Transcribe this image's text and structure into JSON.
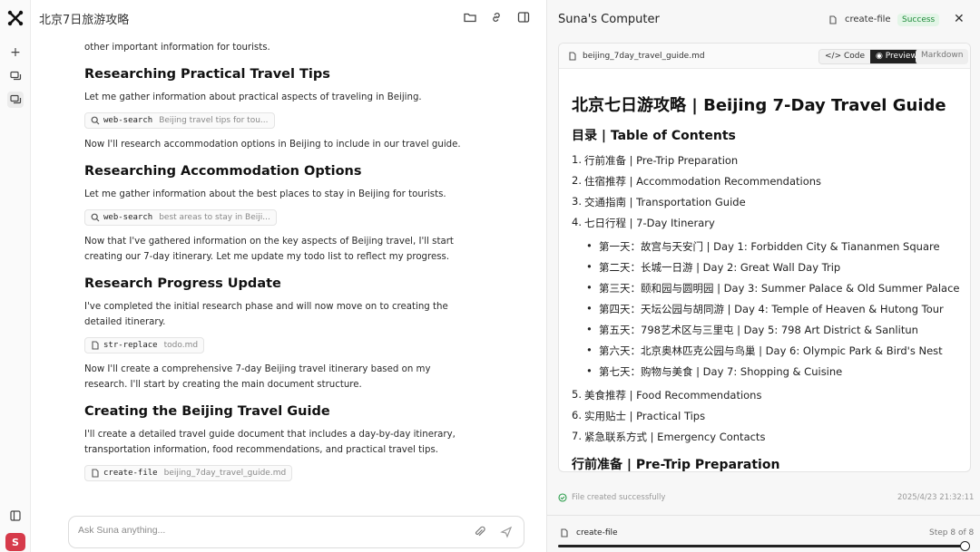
{
  "header": {
    "title": "北京7日旅游攻略"
  },
  "chat": {
    "intro_tail": "other important information for tourists.",
    "sections": [
      {
        "heading": "Researching Practical Travel Tips",
        "text": "Let me gather information about practical aspects of traveling in Beijing.",
        "tool": {
          "name": "web-search",
          "arg": "Beijing travel tips for tou..."
        },
        "after": "Now I'll research accommodation options in Beijing to include in our travel guide."
      },
      {
        "heading": "Researching Accommodation Options",
        "text": "Let me gather information about the best places to stay in Beijing for tourists.",
        "tool": {
          "name": "web-search",
          "arg": "best areas to stay in Beiji..."
        },
        "after": "Now that I've gathered information on the key aspects of Beijing travel, I'll start creating our 7-day itinerary. Let me update my todo list to reflect my progress."
      },
      {
        "heading": "Research Progress Update",
        "text": "I've completed the initial research phase and will now move on to creating the detailed itinerary.",
        "tool": {
          "name": "str-replace",
          "arg": "todo.md"
        },
        "after": "Now I'll create a comprehensive 7-day Beijing travel itinerary based on my research. I'll start by creating the main document structure."
      },
      {
        "heading": "Creating the Beijing Travel Guide",
        "text": "I'll create a detailed travel guide document that includes a day-by-day itinerary, transportation information, food recommendations, and practical travel tips.",
        "tool": {
          "name": "create-file",
          "arg": "beijing_7day_travel_guide.md"
        }
      }
    ],
    "input_placeholder": "Ask Suna anything..."
  },
  "panel": {
    "title": "Suna's Computer",
    "tool_name": "create-file",
    "status": "Success",
    "file_name": "beijing_7day_travel_guide.md",
    "view_code": "Code",
    "view_preview": "Preview",
    "view_markdown": "Markdown",
    "doc": {
      "h1": "北京七日游攻略 | Beijing 7-Day Travel Guide",
      "toc_heading": "目录 | Table of Contents",
      "toc": [
        "行前准备 | Pre-Trip Preparation",
        "住宿推荐 | Accommodation Recommendations",
        "交通指南 | Transportation Guide",
        "七日行程 | 7-Day Itinerary",
        "美食推荐 | Food Recommendations",
        "实用贴士 | Practical Tips",
        "紧急联系方式 | Emergency Contacts"
      ],
      "toc_numbers": [
        "1.",
        "2.",
        "3.",
        "4.",
        "5.",
        "6.",
        "7."
      ],
      "days": [
        "第一天：故宫与天安门 | Day 1: Forbidden City & Tiananmen Square",
        "第二天：长城一日游 | Day 2: Great Wall Day Trip",
        "第三天：颐和园与圆明园 | Day 3: Summer Palace & Old Summer Palace",
        "第四天：天坛公园与胡同游 | Day 4: Temple of Heaven & Hutong Tour",
        "第五天：798艺术区与三里屯 | Day 5: 798 Art District & Sanlitun",
        "第六天：北京奥林匹克公园与鸟巢 | Day 6: Olympic Park & Bird's Nest",
        "第七天：购物与美食 | Day 7: Shopping & Cuisine"
      ],
      "h2_next": "行前准备 | Pre-Trip Preparation"
    },
    "footer_status": "File created successfully",
    "timestamp": "2025/4/23 21:32:11",
    "step_tool": "create-file",
    "step_label": "Step 8 of 8",
    "step_progress": 1.0
  },
  "user": {
    "avatar_initial": "S"
  },
  "colors": {
    "success": "#1f8b3a",
    "avatar": "#d63a4a"
  }
}
